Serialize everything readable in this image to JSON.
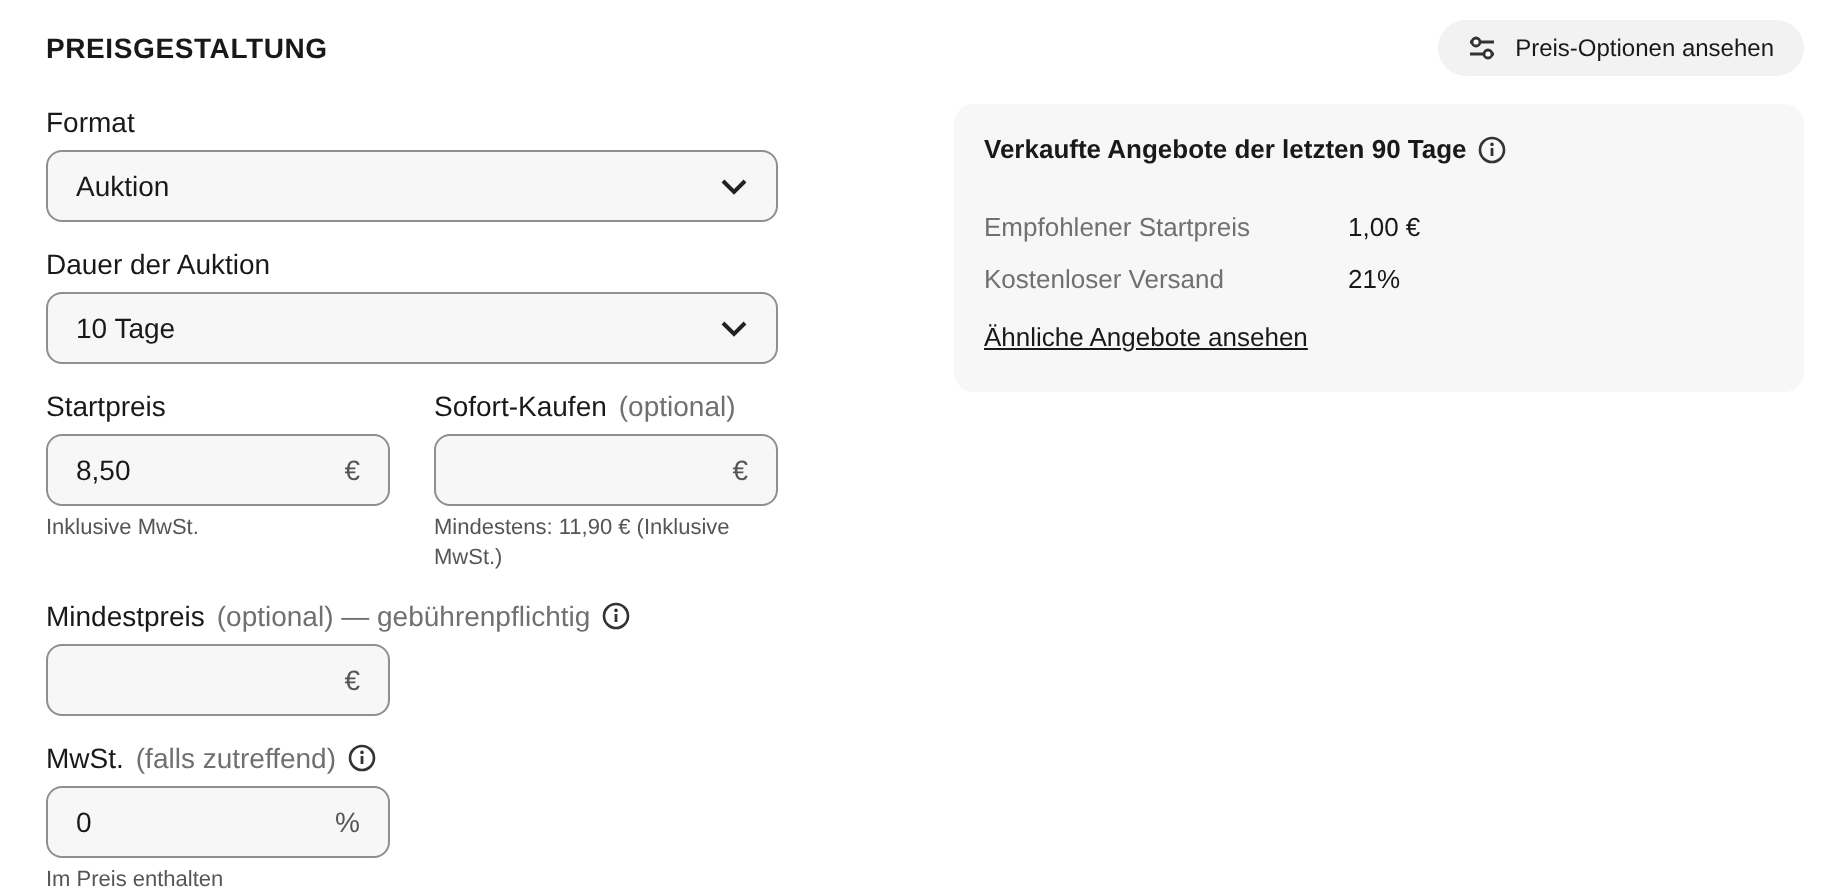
{
  "header": {
    "title": "PREISGESTALTUNG",
    "options_button": "Preis-Optionen ansehen"
  },
  "rows": [
    [
      {
        "kind": "select",
        "label": "Format",
        "value": "Auktion"
      }
    ],
    [
      {
        "kind": "select",
        "label": "Dauer der Auktion",
        "value": "10 Tage"
      }
    ],
    [
      {
        "kind": "input",
        "label": "Startpreis",
        "value": "8,50",
        "unit": "€",
        "hint": "Inklusive MwSt."
      },
      {
        "kind": "input",
        "label": "Sofort-Kaufen",
        "note": "(optional)",
        "unit": "€",
        "hint": "Mindestens: 11,90 € (Inklusive MwSt.)"
      }
    ],
    [
      {
        "kind": "input",
        "label": "Mindestpreis",
        "note": "(optional) — gebührenpflichtig",
        "info": true,
        "unit": "€"
      }
    ],
    [
      {
        "kind": "input",
        "label": "MwSt.",
        "note": "(falls zutreffend)",
        "info": true,
        "value": "0",
        "unit": "%",
        "hint": "Im Preis enthalten"
      }
    ]
  ],
  "sold_panel": {
    "title": "Verkaufte Angebote der letzten 90 Tage",
    "stats": [
      {
        "label": "Empfohlener Startpreis",
        "value": "1,00 €"
      },
      {
        "label": "Kostenloser Versand",
        "value": "21%"
      }
    ],
    "link": "Ähnliche Angebote ansehen"
  }
}
